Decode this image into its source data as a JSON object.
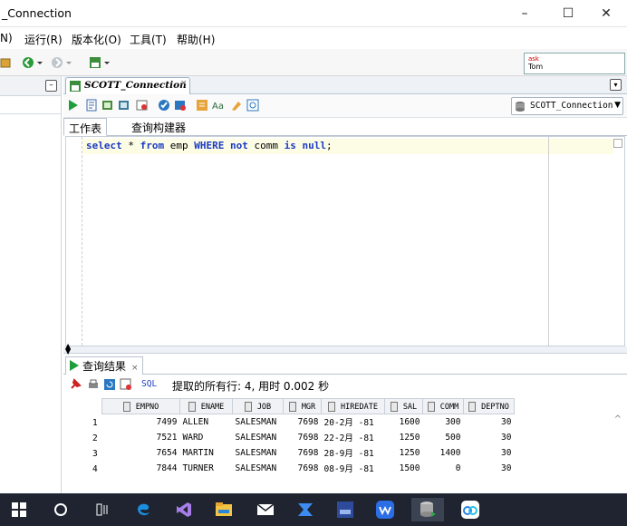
{
  "window": {
    "title": "_Connection",
    "minimize": "–",
    "maximize": "☐",
    "close": "✕"
  },
  "menu": {
    "items": [
      "N)",
      "运行(R)",
      "版本化(O)",
      "工具(T)",
      "帮助(H)"
    ]
  },
  "toolbar": {
    "ask_line1": "ask",
    "ask_line2": "Tom"
  },
  "editor_tab": {
    "label": "SCOTT_Connection",
    "close": "×"
  },
  "connection_select": {
    "value": "SCOTT_Connection"
  },
  "subtabs": {
    "worksheet": "工作表",
    "query_builder": "查询构建器"
  },
  "editor": {
    "tokens": [
      {
        "text": "select",
        "kw": true
      },
      {
        "text": " * ",
        "kw": false
      },
      {
        "text": "from",
        "kw": true
      },
      {
        "text": " emp ",
        "kw": false
      },
      {
        "text": "WHERE",
        "kw": true
      },
      {
        "text": " ",
        "kw": false
      },
      {
        "text": "not",
        "kw": true
      },
      {
        "text": " comm ",
        "kw": false
      },
      {
        "text": "is",
        "kw": true
      },
      {
        "text": " ",
        "kw": false
      },
      {
        "text": "null",
        "kw": true
      },
      {
        "text": ";",
        "kw": false
      }
    ]
  },
  "results": {
    "tab_label": "查询结果",
    "tab_close": "×",
    "sql_label": "SQL",
    "status": "提取的所有行: 4, 用时 0.002 秒",
    "columns": [
      "EMPNO",
      "ENAME",
      "JOB",
      "MGR",
      "HIREDATE",
      "SAL",
      "COMM",
      "DEPTNO"
    ],
    "rows": [
      {
        "n": "1",
        "cells": [
          "7499",
          "ALLEN",
          "SALESMAN",
          "7698",
          "20-2月 -81",
          "1600",
          "300",
          "30"
        ]
      },
      {
        "n": "2",
        "cells": [
          "7521",
          "WARD",
          "SALESMAN",
          "7698",
          "22-2月 -81",
          "1250",
          "500",
          "30"
        ]
      },
      {
        "n": "3",
        "cells": [
          "7654",
          "MARTIN",
          "SALESMAN",
          "7698",
          "28-9月 -81",
          "1250",
          "1400",
          "30"
        ]
      },
      {
        "n": "4",
        "cells": [
          "7844",
          "TURNER",
          "SALESMAN",
          "7698",
          "08-9月 -81",
          "1500",
          "0",
          "30"
        ]
      }
    ]
  },
  "taskbar": {
    "icons": [
      "windows-start",
      "search",
      "task-view",
      "edge",
      "visual-studio",
      "file-explorer",
      "mail",
      "app-blue",
      "app-dark",
      "wps",
      "sqldeveloper",
      "baidu-netdisk"
    ]
  },
  "colors": {
    "keyword": "#1a3ac4",
    "current_line": "#fdfde6",
    "taskbar": "#1f2430"
  }
}
